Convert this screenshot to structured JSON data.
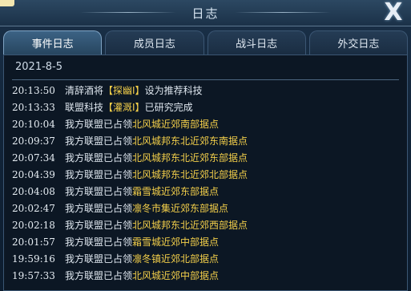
{
  "window": {
    "title": "日志",
    "corner_mark": "",
    "close_label": "X"
  },
  "tabs": [
    {
      "label": "事件日志",
      "active": true
    },
    {
      "label": "成员日志",
      "active": false
    },
    {
      "label": "战斗日志",
      "active": false
    },
    {
      "label": "外交日志",
      "active": false
    }
  ],
  "log": {
    "date": "2021-8-5",
    "highlight_color": "#f3cf4a",
    "entries": [
      {
        "time": "20:13:50",
        "prefix": "清辞酒将",
        "highlight": "【探幽Ⅰ】",
        "suffix": "设为推荐科技"
      },
      {
        "time": "20:13:33",
        "prefix": "联盟科技",
        "highlight": "【灌溉Ⅰ】",
        "suffix": "已研究完成"
      },
      {
        "time": "20:10:04",
        "prefix": "我方联盟已占领",
        "highlight": "北风城近郊南部据点",
        "suffix": ""
      },
      {
        "time": "20:09:37",
        "prefix": "我方联盟已占领",
        "highlight": "北风城邦东北近郊东南据点",
        "suffix": ""
      },
      {
        "time": "20:07:34",
        "prefix": "我方联盟已占领",
        "highlight": "北风城邦东北近郊东部据点",
        "suffix": ""
      },
      {
        "time": "20:04:39",
        "prefix": "我方联盟已占领",
        "highlight": "北风城邦东北近郊北部据点",
        "suffix": ""
      },
      {
        "time": "20:04:08",
        "prefix": "我方联盟已占领",
        "highlight": "霜雪城近郊东部据点",
        "suffix": ""
      },
      {
        "time": "20:02:47",
        "prefix": "我方联盟已占领",
        "highlight": "凛冬市集近郊东部据点",
        "suffix": ""
      },
      {
        "time": "20:02:18",
        "prefix": "我方联盟已占领",
        "highlight": "北风城邦东北近郊西部据点",
        "suffix": ""
      },
      {
        "time": "20:01:57",
        "prefix": "我方联盟已占领",
        "highlight": "霜雪城近郊中部据点",
        "suffix": ""
      },
      {
        "time": "19:59:16",
        "prefix": "我方联盟已占领",
        "highlight": "凛冬镇近郊北部据点",
        "suffix": ""
      },
      {
        "time": "19:57:33",
        "prefix": "我方联盟已占领",
        "highlight": "北风城近郊中部据点",
        "suffix": ""
      }
    ]
  }
}
